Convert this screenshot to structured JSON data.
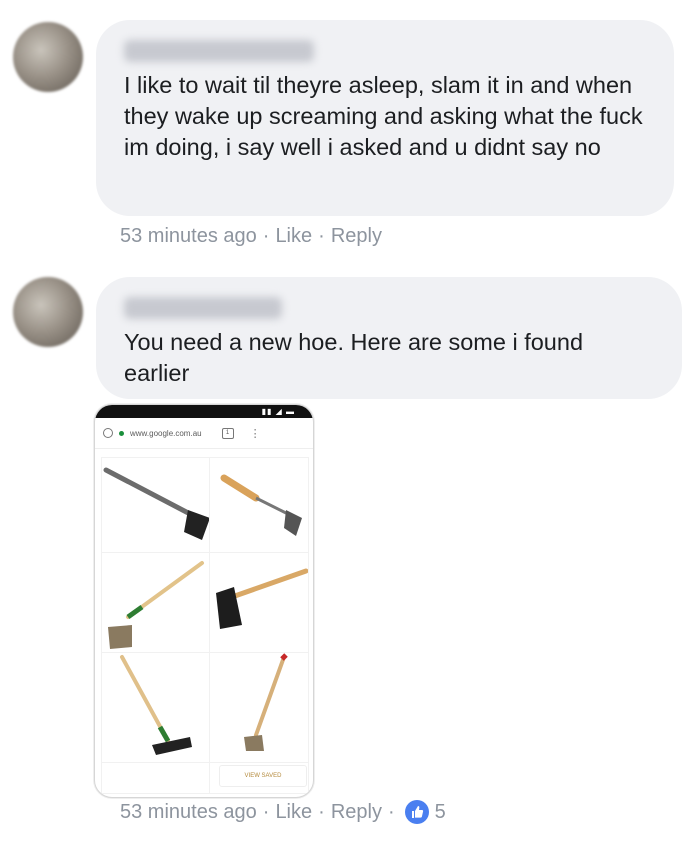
{
  "comments": [
    {
      "text": "I like to wait til theyre asleep, slam it in and when they wake up screaming and asking what the fuck im doing, i say well i asked and u didnt say no",
      "meta": {
        "time": "53 minutes ago",
        "like": "Like",
        "reply": "Reply"
      }
    },
    {
      "text": "You need a new hoe. Here are some i found earlier",
      "meta": {
        "time": "53 minutes ago",
        "like": "Like",
        "reply": "Reply",
        "reaction_count": "5"
      }
    }
  ],
  "attachment": {
    "url_text": "www.google.com.au",
    "button_text": "VIEW SAVED"
  },
  "colors": {
    "bubble": "#f0f1f4",
    "meta_text": "#8d949e",
    "like_reaction": "#4a7ff0"
  }
}
